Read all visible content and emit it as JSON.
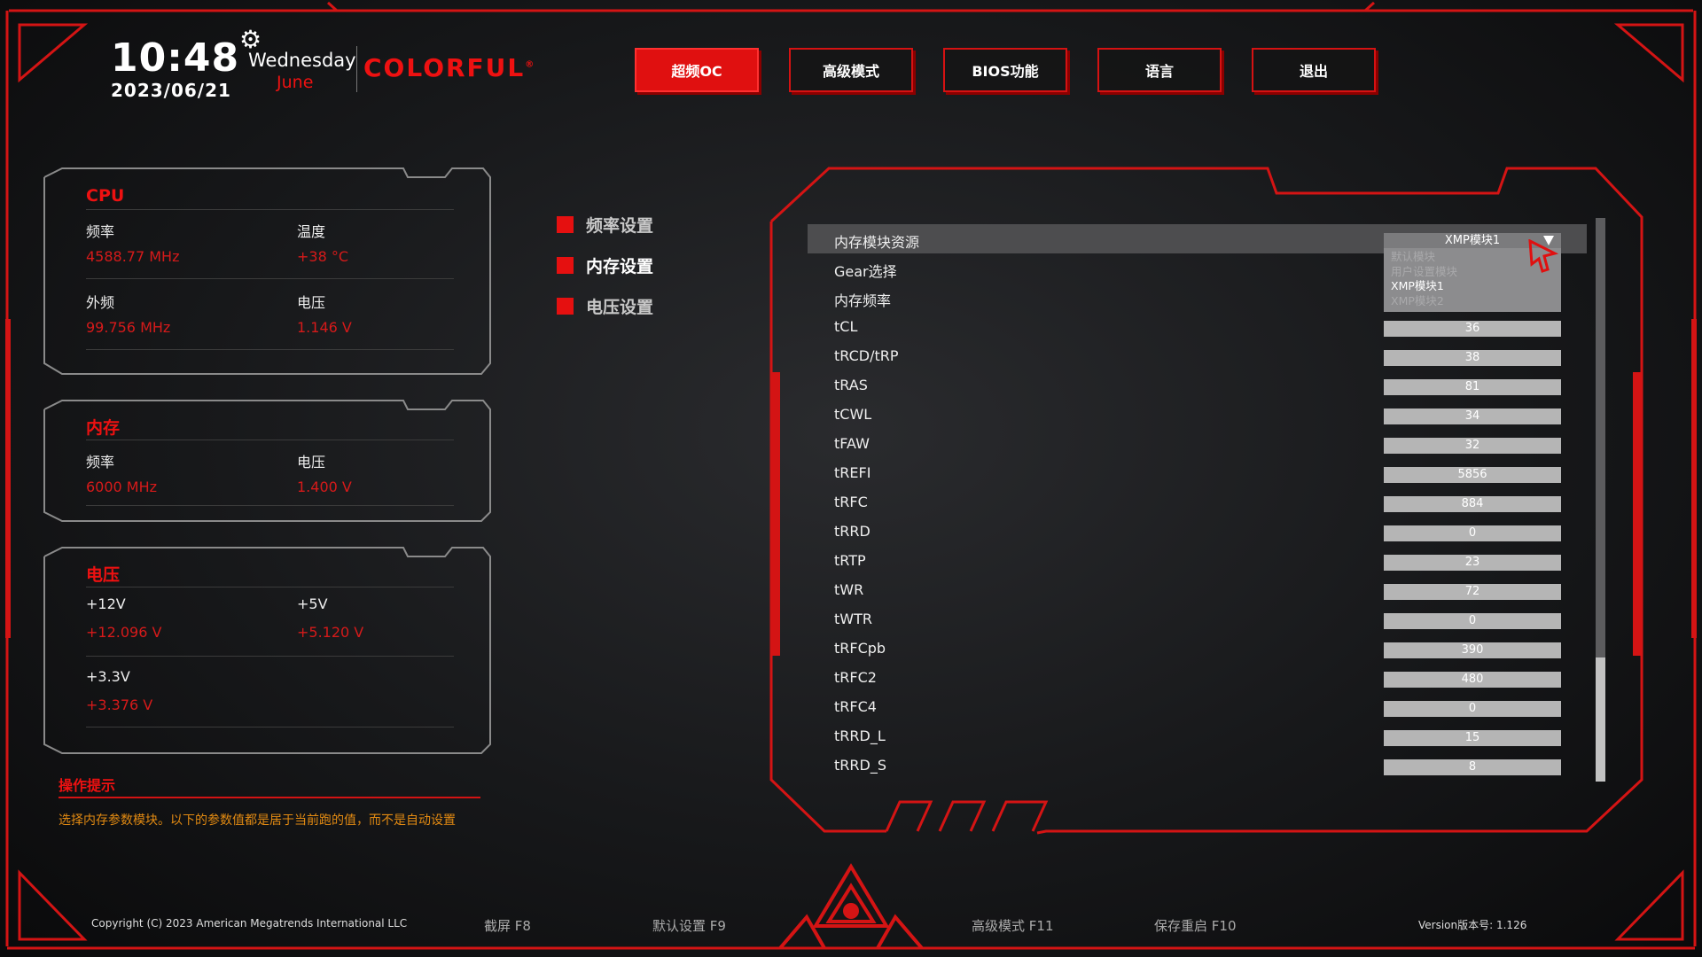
{
  "header": {
    "time": "10:48",
    "date": "2023/06/21",
    "weekday": "Wednesday",
    "month": "June",
    "brand": "COLORFUL",
    "brand_mark": "®",
    "gear_icon": "gear-icon"
  },
  "nav": [
    {
      "label": "超频OC",
      "active": true
    },
    {
      "label": "高级模式",
      "active": false
    },
    {
      "label": "BIOS功能",
      "active": false
    },
    {
      "label": "语言",
      "active": false
    },
    {
      "label": "退出",
      "active": false
    }
  ],
  "cpu_panel": {
    "title": "CPU",
    "freq_label": "频率",
    "freq_value": "4588.77 MHz",
    "temp_label": "温度",
    "temp_value": "+38 °C",
    "bclk_label": "外频",
    "bclk_value": "99.756 MHz",
    "volt_label": "电压",
    "volt_value": "1.146 V"
  },
  "mem_panel": {
    "title": "内存",
    "freq_label": "频率",
    "freq_value": "6000 MHz",
    "volt_label": "电压",
    "volt_value": "1.400 V"
  },
  "volt_panel": {
    "title": "电压",
    "v12_label": "+12V",
    "v12_value": "+12.096 V",
    "v5_label": "+5V",
    "v5_value": "+5.120 V",
    "v33_label": "+3.3V",
    "v33_value": "+3.376 V"
  },
  "tips": {
    "title": "操作提示",
    "text": "选择内存参数模块。以下的参数值都是居于当前跑的值，而不是自动设置"
  },
  "submenu": [
    {
      "label": "频率设置",
      "active": false
    },
    {
      "label": "内存设置",
      "active": true
    },
    {
      "label": "电压设置",
      "active": false
    }
  ],
  "settings": [
    {
      "name": "内存模块资源",
      "value": "XMP模块1"
    },
    {
      "name": "Gear选择",
      "value": ""
    },
    {
      "name": "内存频率",
      "value": ""
    },
    {
      "name": "tCL",
      "value": "36"
    },
    {
      "name": "tRCD/tRP",
      "value": "38"
    },
    {
      "name": "tRAS",
      "value": "81"
    },
    {
      "name": "tCWL",
      "value": "34"
    },
    {
      "name": "tFAW",
      "value": "32"
    },
    {
      "name": "tREFI",
      "value": "5856"
    },
    {
      "name": "tRFC",
      "value": "884"
    },
    {
      "name": "tRRD",
      "value": "0"
    },
    {
      "name": "tRTP",
      "value": "23"
    },
    {
      "name": "tWR",
      "value": "72"
    },
    {
      "name": "tWTR",
      "value": "0"
    },
    {
      "name": "tRFCpb",
      "value": "390"
    },
    {
      "name": "tRFC2",
      "value": "480"
    },
    {
      "name": "tRFC4",
      "value": "0"
    },
    {
      "name": "tRRD_L",
      "value": "15"
    },
    {
      "name": "tRRD_S",
      "value": "8"
    }
  ],
  "dropdown": {
    "options": [
      "默认模块",
      "用户设置模块",
      "XMP模块1",
      "XMP模块2"
    ],
    "selected": "XMP模块1"
  },
  "footer": {
    "copyright": "Copyright (C) 2023 American Megatrends International LLC",
    "f8": "截屏 F8",
    "f9": "默认设置 F9",
    "f11": "高级模式 F11",
    "f10": "保存重启 F10",
    "version": "Version版本号: 1.126"
  },
  "colors": {
    "accent": "#e01010",
    "panel_border": "#8a8a8a",
    "tip_text": "#e28a12"
  },
  "scrollbar": {
    "position": 0.78
  }
}
